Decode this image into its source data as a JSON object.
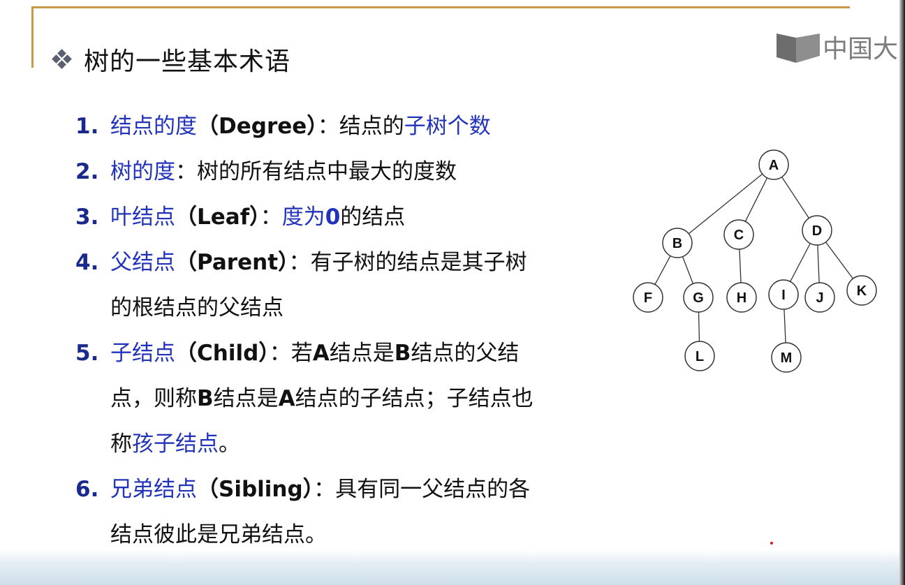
{
  "title": {
    "text": "树的一些基本术语",
    "bullet_icon": "diamond-bullet-icon"
  },
  "logo": {
    "text": "中国大",
    "icon": "book-logo-icon"
  },
  "items": [
    {
      "num": "1.",
      "term": "结点的度",
      "paren": "（Degree）",
      "colon": "：",
      "def_plain": "结点的",
      "def_blue": "子树个数"
    },
    {
      "num": "2.",
      "term": "树的度",
      "colon": "：",
      "def": "树的所有结点中最大的度数"
    },
    {
      "num": "3.",
      "term": "叶结点",
      "paren": "（Leaf）",
      "colon": "：",
      "def_blue": "度为",
      "def_bold_blue": "0",
      "def_plain": "的结点"
    },
    {
      "num": "4.",
      "term": "父结点",
      "paren": "（Parent）",
      "colon": "：",
      "def_line1": "有子树的结点是其子树",
      "def_line2": "的根结点的父结点"
    },
    {
      "num": "5.",
      "term": "子结点",
      "paren": "（Child）",
      "colon": "：",
      "l1_a": "若",
      "l1_b": "A",
      "l1_c": "结点是",
      "l1_d": "B",
      "l1_e": "结点的父结",
      "l2_a": "点，则称",
      "l2_b": "B",
      "l2_c": "结点是",
      "l2_d": "A",
      "l2_e": "结点的子结点；子结点也",
      "l3_a": "称",
      "l3_blue": "孩子结点",
      "l3_end": "。"
    },
    {
      "num": "6.",
      "term": "兄弟结点",
      "paren": "（Sibling）",
      "colon": "：",
      "def_line1": "具有同一父结点的各",
      "def_line2": "结点彼此是兄弟结点。"
    }
  ],
  "tree": {
    "nodes": [
      "A",
      "B",
      "C",
      "D",
      "F",
      "G",
      "H",
      "I",
      "J",
      "K",
      "L",
      "M"
    ],
    "edges": [
      [
        "A",
        "B"
      ],
      [
        "A",
        "C"
      ],
      [
        "A",
        "D"
      ],
      [
        "B",
        "F"
      ],
      [
        "B",
        "G"
      ],
      [
        "C",
        "H"
      ],
      [
        "D",
        "I"
      ],
      [
        "D",
        "J"
      ],
      [
        "D",
        "K"
      ],
      [
        "G",
        "L"
      ],
      [
        "I",
        "M"
      ]
    ]
  }
}
